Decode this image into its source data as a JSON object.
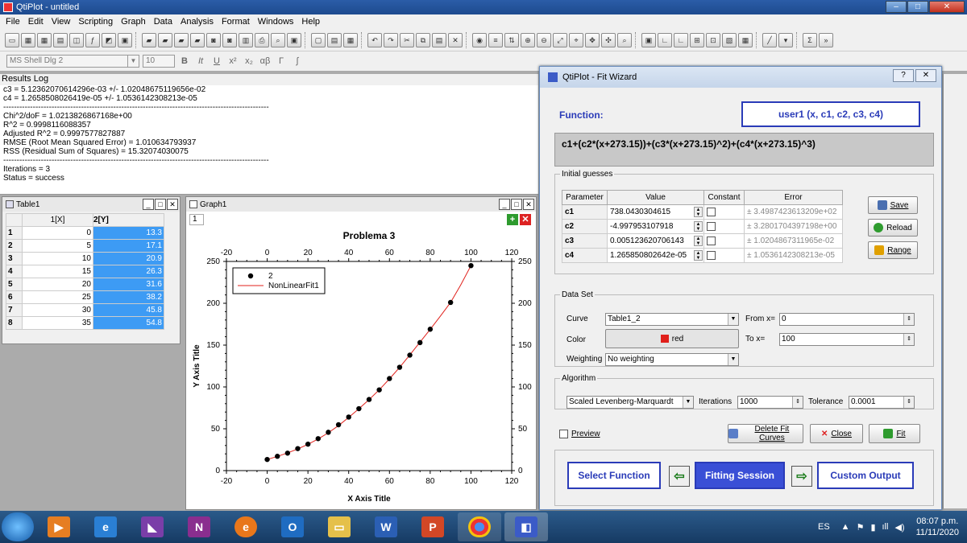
{
  "window": {
    "title": "QtiPlot - untitled"
  },
  "menu": [
    "File",
    "Edit",
    "View",
    "Scripting",
    "Graph",
    "Data",
    "Analysis",
    "Format",
    "Windows",
    "Help"
  ],
  "format": {
    "font": "MS Shell Dlg 2",
    "size": "10"
  },
  "results": {
    "header": "Results Log",
    "lines": [
      "c3 = 5.12362070614296e-03 +/- 1.02048675119656e-02",
      "c4 = 1.2658508026419e-05 +/- 1.0536142308213e-05",
      "---------------------------------------------------------------------------------------------------",
      "Chi^2/doF = 1.0213826867168e+00",
      "R^2 = 0.9998116088357",
      "Adjusted R^2 = 0.9997577827887",
      "RMSE (Root Mean Squared Error) = 1.010634793937",
      "RSS (Residual Sum of Squares) = 15.32074030075",
      "---------------------------------------------------------------------------------------------------",
      "Iterations = 3",
      "Status = success"
    ]
  },
  "table": {
    "title": "Table1",
    "col_x": "1[X]",
    "col_y": "2[Y]",
    "rows": [
      {
        "n": "1",
        "x": "0",
        "y": "13.3"
      },
      {
        "n": "2",
        "x": "5",
        "y": "17.1"
      },
      {
        "n": "3",
        "x": "10",
        "y": "20.9"
      },
      {
        "n": "4",
        "x": "15",
        "y": "26.3"
      },
      {
        "n": "5",
        "x": "20",
        "y": "31.6"
      },
      {
        "n": "6",
        "x": "25",
        "y": "38.2"
      },
      {
        "n": "7",
        "x": "30",
        "y": "45.8"
      },
      {
        "n": "8",
        "x": "35",
        "y": "54.8"
      }
    ]
  },
  "graph": {
    "window_title": "Graph1",
    "layer": "1"
  },
  "chart_data": {
    "type": "scatter",
    "title": "Problema 3",
    "xlabel": "X Axis Title",
    "ylabel": "Y Axis Title",
    "xlim": [
      -20,
      120
    ],
    "ylim": [
      0,
      250
    ],
    "xticks": [
      -20,
      0,
      20,
      40,
      60,
      80,
      100,
      120
    ],
    "yticks": [
      0,
      50,
      100,
      150,
      200,
      250
    ],
    "legend_position": "top-left",
    "series": [
      {
        "name": "2",
        "style": "points",
        "color": "#000000",
        "x": [
          0,
          5,
          10,
          15,
          20,
          25,
          30,
          35,
          40,
          45,
          50,
          55,
          60,
          65,
          70,
          75,
          80,
          90,
          100
        ],
        "y": [
          13.3,
          17.1,
          20.9,
          26.3,
          31.6,
          38.2,
          45.8,
          54.8,
          64.0,
          74.0,
          85.0,
          96.5,
          110.0,
          123.5,
          138.0,
          153.0,
          169.0,
          201.0,
          245.0
        ]
      },
      {
        "name": "NonLinearFit1",
        "style": "line",
        "color": "#e0201b",
        "x": [
          0,
          5,
          10,
          15,
          20,
          25,
          30,
          35,
          40,
          45,
          50,
          55,
          60,
          65,
          70,
          75,
          80,
          85,
          90,
          95,
          100
        ],
        "y": [
          13.3,
          17.0,
          21.1,
          25.9,
          31.4,
          37.8,
          45.2,
          53.8,
          63.6,
          73.9,
          84.8,
          96.6,
          109.6,
          123.4,
          138.3,
          153.5,
          168.8,
          184.7,
          201.0,
          222.0,
          245.0
        ]
      }
    ]
  },
  "wizard": {
    "title": "QtiPlot - Fit Wizard",
    "function_label": "Function:",
    "function_name": "user1 (x, c1, c2, c3, c4)",
    "formula": "c1+(c2*(x+273.15))+(c3*(x+273.15)^2)+(c4*(x+273.15)^3)",
    "initial_guesses": {
      "legend": "Initial guesses",
      "headers": [
        "Parameter",
        "Value",
        "Constant",
        "Error"
      ],
      "rows": [
        {
          "p": "c1",
          "v": "738.0430304615",
          "e": "± 3.4987423613209e+02"
        },
        {
          "p": "c2",
          "v": "-4.997953107918",
          "e": "± 3.2801704397198e+00"
        },
        {
          "p": "c3",
          "v": "0.005123620706143",
          "e": "± 1.0204867311965e-02"
        },
        {
          "p": "c4",
          "v": "1.265850802642e-05",
          "e": "± 1.0536142308213e-05"
        }
      ],
      "save": "Save",
      "reload": "Reload",
      "range": "Range"
    },
    "data_set": {
      "legend": "Data Set",
      "curve_label": "Curve",
      "curve": "Table1_2",
      "from_label": "From x=",
      "from": "0",
      "to_label": "To x=",
      "to": "100",
      "color_label": "Color",
      "color": "red",
      "color_hex": "#e0201b",
      "weighting_label": "Weighting",
      "weighting": "No weighting"
    },
    "algorithm": {
      "legend": "Algorithm",
      "method": "Scaled Levenberg-Marquardt",
      "iterations_label": "Iterations",
      "iterations": "1000",
      "tolerance_label": "Tolerance",
      "tolerance": "0.0001"
    },
    "preview": "Preview",
    "delete": "Delete Fit Curves",
    "close": "Close",
    "fit": "Fit",
    "select_function": "Select Function",
    "fitting_session": "Fitting Session",
    "custom_output": "Custom Output"
  },
  "taskbar": {
    "lang": "ES",
    "time": "08:07 p.m.",
    "date": "11/11/2020"
  }
}
